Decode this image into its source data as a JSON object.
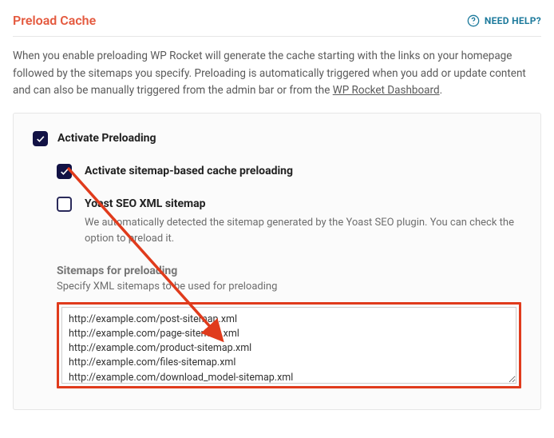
{
  "header": {
    "title": "Preload Cache",
    "help_label": "NEED HELP?"
  },
  "intro": {
    "text_before_link": "When you enable preloading WP Rocket will generate the cache starting with the links on your homepage followed by the sitemaps you specify. Preloading is automatically triggered when you add or update content and can also be manually triggered from the admin bar or from the ",
    "link_text": "WP Rocket Dashboard",
    "text_after_link": "."
  },
  "options": {
    "activate_preloading": {
      "label": "Activate Preloading",
      "checked": true
    },
    "activate_sitemap": {
      "label": "Activate sitemap-based cache preloading",
      "checked": true
    },
    "yoast": {
      "label": "Yoast SEO XML sitemap",
      "desc": "We automatically detected the sitemap generated by the Yoast SEO plugin. You can check the option to preload it.",
      "checked": false
    }
  },
  "sitemaps_section": {
    "title": "Sitemaps for preloading",
    "desc": "Specify XML sitemaps to be used for preloading",
    "value": "http://example.com/post-sitemap.xml\nhttp://example.com/page-sitemap.xml\nhttp://example.com/product-sitemap.xml\nhttp://example.com/files-sitemap.xml\nhttp://example.com/download_model-sitemap.xml"
  }
}
